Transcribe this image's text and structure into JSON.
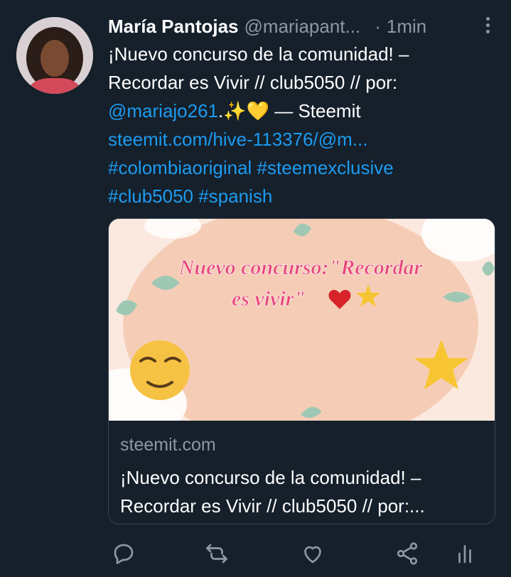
{
  "tweet": {
    "author_name": "María Pantojas",
    "author_handle": "@mariapant...",
    "separator": "·",
    "time": "1min",
    "text_line_1": "¡Nuevo concurso de la comunidad! –",
    "text_line_2": "Recordar es Vivir // club5050 // por:",
    "mention": "@mariajo261",
    "text_line_3_rest": ".✨💛 — Steemit",
    "url": "steemit.com/hive-113376/@m...",
    "hashtags_line_1": "#colombiaoriginal #steemexclusive",
    "hashtags_line_2": "#club5050 #spanish"
  },
  "card": {
    "image_text_1": "Nuevo concurso:\"Recordar",
    "image_text_2": "es vivir\"",
    "domain": "steemit.com",
    "title_line_1": "¡Nuevo concurso de la comunidad! –",
    "title_line_2": "Recordar es Vivir // club5050 // por:..."
  },
  "icons": [
    "more-icon",
    "reply-icon",
    "retweet-icon",
    "like-icon",
    "share-icon",
    "analytics-icon"
  ],
  "colors": {
    "background": "#15202b",
    "link": "#1d9bf0",
    "muted": "#8b98a5",
    "card_title_pink": "#e8457a"
  }
}
